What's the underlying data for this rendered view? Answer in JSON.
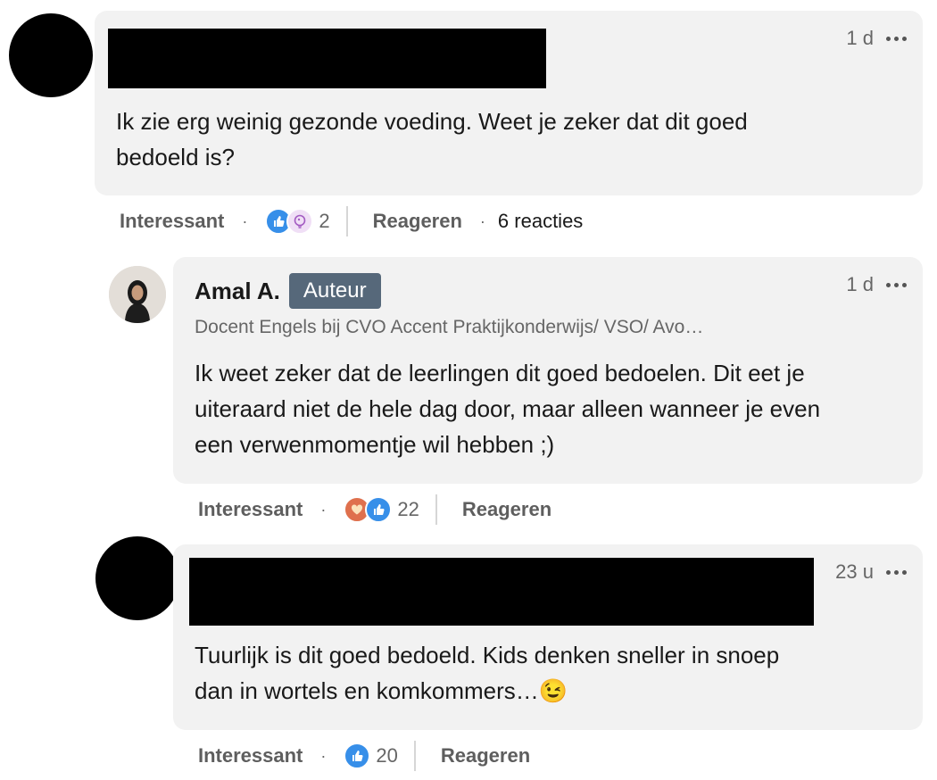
{
  "comments": [
    {
      "time": "1 d",
      "text_line1": "Ik zie erg weinig gezonde voeding. Weet je zeker dat dit goed",
      "text_line2": "bedoeld is?",
      "actions": {
        "like_label": "Interessant",
        "reaction_count": "2",
        "reply_label": "Reageren",
        "replies": "6 reacties"
      }
    },
    {
      "author": "Amal A.",
      "badge": "Auteur",
      "headline": "Docent Engels bij CVO Accent Praktijkonderwijs/ VSO/ Avo…",
      "time": "1 d",
      "text_line1": "Ik weet zeker dat de leerlingen dit goed bedoelen. Dit eet je",
      "text_line2": "uiteraard niet de hele dag door, maar alleen wanneer je even",
      "text_line3": "een verwenmomentje wil hebben ;)",
      "actions": {
        "like_label": "Interessant",
        "reaction_count": "22",
        "reply_label": "Reageren"
      }
    },
    {
      "time": "23 u",
      "text_line1": "Tuurlijk is dit goed bedoeld. Kids denken sneller in snoep",
      "text_line2": "dan in wortels en komkommers…",
      "emoji": "😉",
      "actions": {
        "like_label": "Interessant",
        "reaction_count": "20",
        "reply_label": "Reageren"
      }
    }
  ],
  "icons": {
    "like": "like-icon",
    "insightful": "insightful-icon",
    "love": "love-icon",
    "more": "more-options-icon"
  },
  "colors": {
    "like_blue": "#378fe9",
    "love_red": "#df704d",
    "insightful_purple": "#c37fd9",
    "badge": "#56687a"
  }
}
